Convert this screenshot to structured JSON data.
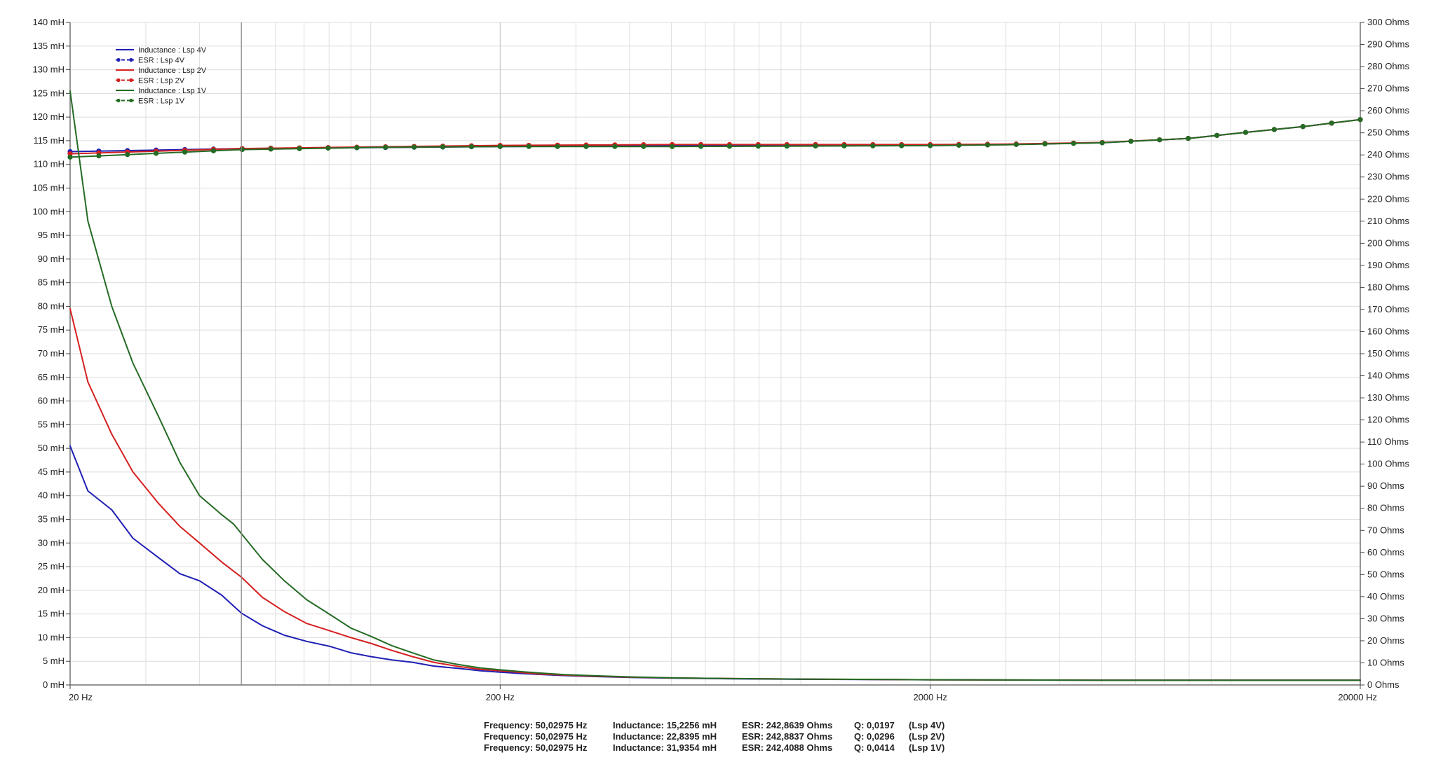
{
  "chart_data": {
    "type": "line",
    "x_scale": "log",
    "xlim": [
      20,
      20000
    ],
    "x_ticks": [
      20,
      200,
      2000,
      20000
    ],
    "x_tick_labels": [
      "20 Hz",
      "200 Hz",
      "2000 Hz",
      "20000 Hz"
    ],
    "ylim_left": [
      0,
      140
    ],
    "y_left_ticks": [
      0,
      5,
      10,
      15,
      20,
      25,
      30,
      35,
      40,
      45,
      50,
      55,
      60,
      65,
      70,
      75,
      80,
      85,
      90,
      95,
      100,
      105,
      110,
      115,
      120,
      125,
      130,
      135,
      140
    ],
    "y_left_tick_labels": [
      "0 mH",
      "5 mH",
      "10 mH",
      "15 mH",
      "20 mH",
      "25 mH",
      "30 mH",
      "35 mH",
      "40 mH",
      "45 mH",
      "50 mH",
      "55 mH",
      "60 mH",
      "65 mH",
      "70 mH",
      "75 mH",
      "80 mH",
      "85 mH",
      "90 mH",
      "95 mH",
      "100 mH",
      "105 mH",
      "110 mH",
      "115 mH",
      "120 mH",
      "125 mH",
      "130 mH",
      "135 mH",
      "140 mH"
    ],
    "ylim_right": [
      0,
      300
    ],
    "y_right_ticks": [
      0,
      10,
      20,
      30,
      40,
      50,
      60,
      70,
      80,
      90,
      100,
      110,
      120,
      130,
      140,
      150,
      160,
      170,
      180,
      190,
      200,
      210,
      220,
      230,
      240,
      250,
      260,
      270,
      280,
      290,
      300
    ],
    "y_right_tick_labels": [
      "0 Ohms",
      "10 Ohms",
      "20 Ohms",
      "30 Ohms",
      "40 Ohms",
      "50 Ohms",
      "60 Ohms",
      "70 Ohms",
      "80 Ohms",
      "90 Ohms",
      "100 Ohms",
      "110 Ohms",
      "120 Ohms",
      "130 Ohms",
      "140 Ohms",
      "150 Ohms",
      "160 Ohms",
      "170 Ohms",
      "180 Ohms",
      "190 Ohms",
      "200 Ohms",
      "210 Ohms",
      "220 Ohms",
      "230 Ohms",
      "240 Ohms",
      "250 Ohms",
      "260 Ohms",
      "270 Ohms",
      "280 Ohms",
      "290 Ohms",
      "300 Ohms"
    ],
    "grid": true,
    "legend_position": "top-left",
    "cursor_x": 50.03,
    "series": [
      {
        "name": "Inductance : Lsp 4V",
        "axis": "left",
        "color": "#1f1fb4",
        "style": "solid",
        "x": [
          20,
          22,
          25,
          28,
          32,
          36,
          40,
          45,
          50,
          56,
          63,
          71,
          80,
          90,
          100,
          112,
          125,
          140,
          160,
          180,
          200,
          225,
          250,
          280,
          320,
          400,
          500,
          700,
          1000,
          2000,
          5000,
          10000,
          20000
        ],
        "y": [
          50.5,
          41,
          37,
          31,
          27,
          23.5,
          22,
          19,
          15.2,
          12.5,
          10.5,
          9.2,
          8.2,
          6.8,
          6,
          5.3,
          4.8,
          4.0,
          3.5,
          3.0,
          2.7,
          2.4,
          2.2,
          2.0,
          1.8,
          1.6,
          1.45,
          1.3,
          1.2,
          1.1,
          1.0,
          1.0,
          1.0
        ]
      },
      {
        "name": "ESR : Lsp 4V",
        "axis": "right",
        "color": "#1f1fb4",
        "style": "dashed-dot",
        "x": [
          20,
          50,
          100,
          200,
          500,
          1000,
          2000,
          3000,
          5000,
          8000,
          10000,
          15000,
          20000
        ],
        "y": [
          241.5,
          242.9,
          243.3,
          243.8,
          244.2,
          244.3,
          244.5,
          244.7,
          245.5,
          247.5,
          249.5,
          253.0,
          256.0
        ]
      },
      {
        "name": "Inductance : Lsp 2V",
        "axis": "left",
        "color": "#d42020",
        "style": "solid",
        "x": [
          20,
          22,
          25,
          28,
          32,
          36,
          40,
          45,
          50,
          56,
          63,
          71,
          80,
          90,
          100,
          112,
          125,
          140,
          160,
          180,
          200,
          225,
          250,
          280,
          320,
          400,
          500,
          700,
          1000,
          2000,
          5000,
          10000,
          20000
        ],
        "y": [
          79.5,
          64,
          53,
          45,
          38.5,
          33.5,
          30,
          26,
          22.8,
          18.5,
          15.5,
          13,
          11.5,
          10,
          8.8,
          7.3,
          6.0,
          4.8,
          3.9,
          3.3,
          3.0,
          2.6,
          2.3,
          2.1,
          1.9,
          1.65,
          1.5,
          1.35,
          1.25,
          1.1,
          1.0,
          1.0,
          1.0
        ]
      },
      {
        "name": "ESR : Lsp 2V",
        "axis": "right",
        "color": "#d42020",
        "style": "dashed-dot",
        "x": [
          20,
          50,
          100,
          200,
          500,
          1000,
          2000,
          3000,
          5000,
          8000,
          10000,
          15000,
          20000
        ],
        "y": [
          240.5,
          242.9,
          243.6,
          244.3,
          244.7,
          244.7,
          244.7,
          244.9,
          245.6,
          247.5,
          249.5,
          253.0,
          256.0
        ]
      },
      {
        "name": "Inductance : Lsp 1V",
        "axis": "left",
        "color": "#246b24",
        "style": "solid",
        "x": [
          20,
          22,
          25,
          28,
          32,
          36,
          40,
          45,
          48,
          50,
          56,
          63,
          71,
          80,
          90,
          100,
          112,
          125,
          140,
          160,
          180,
          200,
          225,
          250,
          280,
          320,
          400,
          500,
          700,
          1000,
          2000,
          5000,
          10000,
          20000
        ],
        "y": [
          125.5,
          98,
          80,
          68,
          57,
          47,
          40,
          36,
          34,
          32,
          26.5,
          22,
          18,
          15,
          12,
          10.3,
          8.3,
          6.8,
          5.3,
          4.3,
          3.6,
          3.2,
          2.8,
          2.5,
          2.2,
          2.0,
          1.7,
          1.5,
          1.35,
          1.25,
          1.1,
          1.0,
          1.0,
          1.0
        ]
      },
      {
        "name": "ESR : Lsp 1V",
        "axis": "right",
        "color": "#246b24",
        "style": "dashed-dot",
        "x": [
          20,
          50,
          100,
          200,
          500,
          1000,
          2000,
          3000,
          5000,
          8000,
          10000,
          15000,
          20000
        ],
        "y": [
          239.0,
          242.4,
          243.4,
          243.8,
          243.8,
          244.0,
          244.2,
          244.6,
          245.5,
          247.5,
          249.5,
          253.0,
          256.0
        ]
      }
    ]
  },
  "readout": [
    {
      "frequency": "Frequency: 50,02975 Hz",
      "inductance": "Inductance: 15,2256 mH",
      "esr": "ESR: 242,8639 Ohms",
      "q": "Q: 0,0197",
      "label": "(Lsp 4V)"
    },
    {
      "frequency": "Frequency: 50,02975 Hz",
      "inductance": "Inductance: 22,8395 mH",
      "esr": "ESR: 242,8837 Ohms",
      "q": "Q: 0,0296",
      "label": "(Lsp 2V)"
    },
    {
      "frequency": "Frequency: 50,02975 Hz",
      "inductance": "Inductance: 31,9354 mH",
      "esr": "ESR: 242,4088 Ohms",
      "q": "Q: 0,0414",
      "label": "(Lsp 1V)"
    }
  ]
}
